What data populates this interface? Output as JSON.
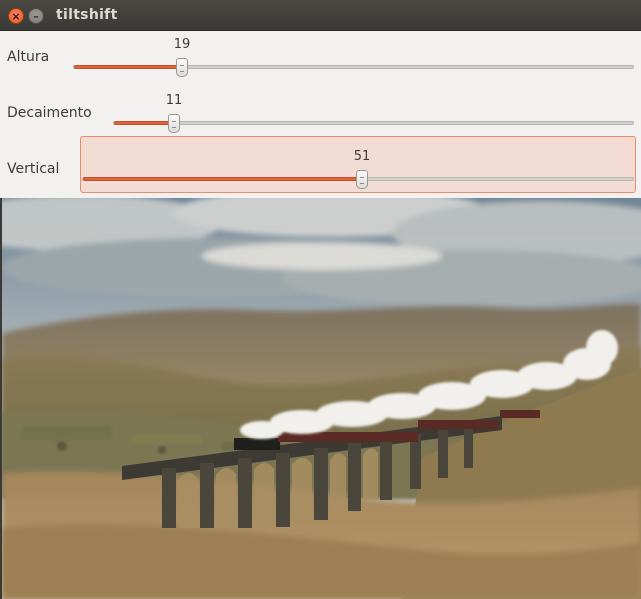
{
  "window": {
    "title": "tiltshift"
  },
  "sliders": [
    {
      "label": "Altura",
      "value": "19",
      "level": 0.19
    },
    {
      "label": "Decaimento",
      "value": "11",
      "level": 0.11
    },
    {
      "label": "Vertical",
      "value": "51",
      "level": 0.51
    }
  ],
  "colors": {
    "accent": "#e0653a",
    "titlebar": "#3c3b37",
    "panel": "#f2f1f0"
  },
  "icons": {
    "close": "close-icon",
    "minimize": "minimize-icon"
  }
}
